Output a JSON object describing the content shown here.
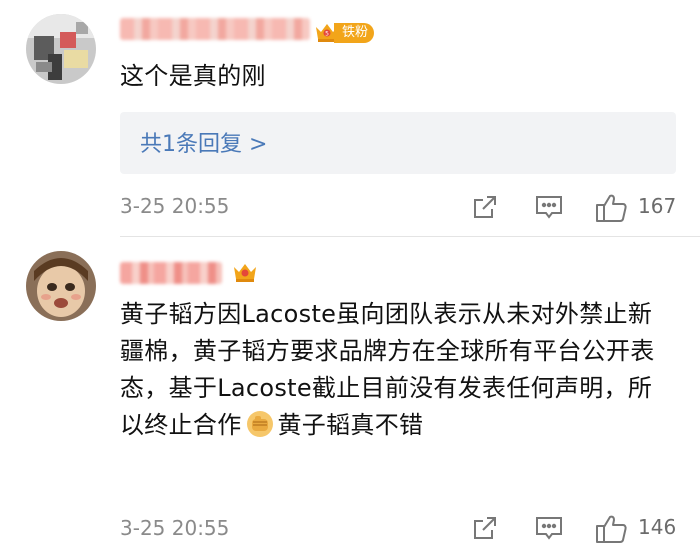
{
  "comments": [
    {
      "text": "这个是真的刚",
      "fan_badge": "铁粉",
      "reply_summary": "共1条回复 >",
      "time": "3-25 20:55",
      "likes": "167"
    },
    {
      "text_part1": "黄子韬方因Lacoste虽向团队表示从未对外禁止新疆棉，黄子韬方要求品牌方在全球所有平台公开表态，基于Lacoste截止目前没有发表任何声明，所以终止合作",
      "text_part2": "黄子韬真不错",
      "time": "3-25 20:55",
      "likes": "146"
    }
  ],
  "icons": {
    "crown": "crown-badge-icon",
    "share": "share-icon",
    "reply": "comment-icon",
    "like": "thumbs-up-icon",
    "emoji": "fist-emoji-icon"
  },
  "colors": {
    "link": "#4a79b8",
    "badge": "#f2a51a",
    "meta": "#8a8a8a"
  }
}
